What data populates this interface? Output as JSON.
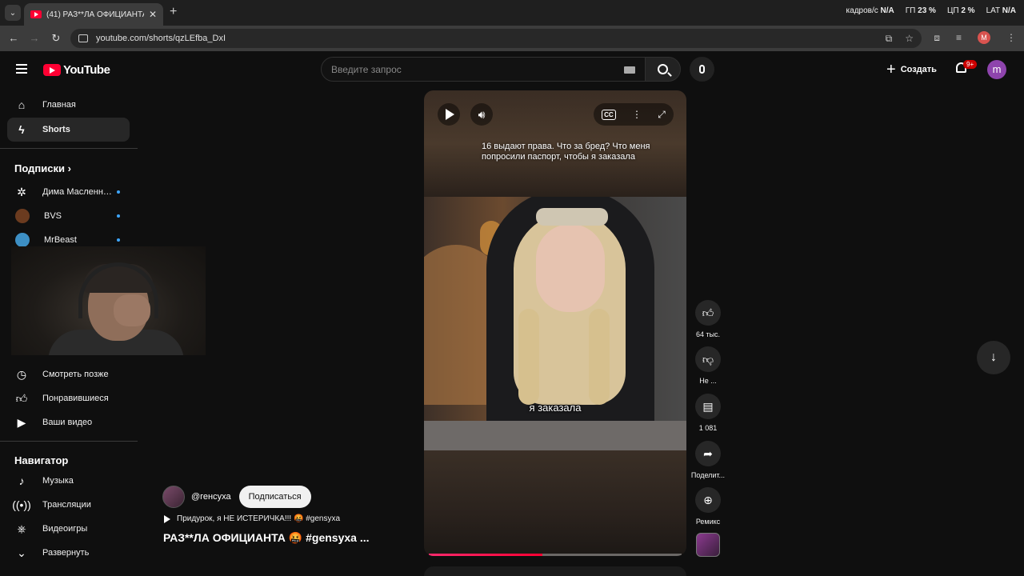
{
  "browser": {
    "tab_title": "(41) РАЗ**ЛА ОФИЦИАНТА 🤬",
    "tab_close": "✕",
    "new_tab": "+",
    "url": "youtube.com/shorts/qzLEfba_DxI",
    "sys": {
      "fps_label": "кадров/с",
      "fps_value": "N/A",
      "gpu_label": "ГП",
      "gpu_value": "23 %",
      "cpu_label": "ЦП",
      "cpu_value": "2 %",
      "lat_label": "LAT",
      "lat_value": "N/A"
    },
    "profile_letter": "M"
  },
  "header": {
    "logo_text": "YouTube",
    "search_placeholder": "Введите запрос",
    "create_label": "Создать",
    "notif_badge": "9+",
    "avatar_letter": "m"
  },
  "sidebar": {
    "home": "Главная",
    "shorts": "Shorts",
    "subs_heading": "Подписки",
    "subscriptions": [
      {
        "name": "Дима Масленн…"
      },
      {
        "name": "BVS"
      },
      {
        "name": "MrBeast"
      }
    ],
    "watch_later": "Смотреть позже",
    "liked": "Понравившиеся",
    "your_videos": "Ваши видео",
    "nav_heading": "Навигатор",
    "music": "Музыка",
    "live": "Трансляции",
    "gaming": "Видеоигры",
    "expand": "Развернуть"
  },
  "player": {
    "overlay_text": "16 выдают права. Что за бред? Что меня попросили паспорт, чтобы я заказала",
    "caption": "я заказала",
    "cc_label": "CC",
    "progress": 0.45
  },
  "info": {
    "channel": "@генсуха",
    "subscribe": "Подписаться",
    "music": "Придурок, я НЕ ИСТЕРИЧКА!!! 🤬 #gensyxa",
    "title": "РАЗ**ЛА ОФИЦИАНТА 🤬 #gensyxa ..."
  },
  "actions": {
    "likes": "64 тыс.",
    "dislike": "Не ...",
    "comments": "1 081",
    "share": "Поделит...",
    "remix": "Ремикс"
  }
}
